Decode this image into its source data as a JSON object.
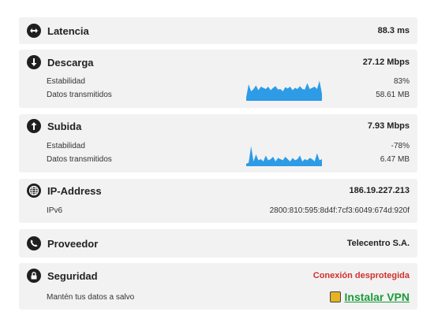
{
  "latency": {
    "title": "Latencia",
    "value": "88.3 ms",
    "icon": "arrows-horizontal-icon"
  },
  "download": {
    "title": "Descarga",
    "value": "27.12 Mbps",
    "icon": "arrow-down-icon",
    "stability_label": "Estabilidad",
    "stability_value": "83%",
    "data_label": "Datos transmitidos",
    "data_value": "58.61 MB",
    "sparkline": [
      0.15,
      0.7,
      0.4,
      0.5,
      0.65,
      0.45,
      0.6,
      0.55,
      0.5,
      0.6,
      0.45,
      0.55,
      0.62,
      0.48,
      0.5,
      0.4,
      0.58,
      0.52,
      0.6,
      0.45,
      0.55,
      0.5,
      0.62,
      0.5,
      0.48,
      0.75,
      0.5,
      0.55,
      0.6,
      0.5,
      0.85,
      0.3
    ],
    "sparkline_color": "#2e9be6"
  },
  "upload": {
    "title": "Subida",
    "value": "7.93 Mbps",
    "icon": "arrow-up-icon",
    "stability_label": "Estabilidad",
    "stability_value": "-78%",
    "data_label": "Datos transmitidos",
    "data_value": "6.47 MB",
    "sparkline": [
      0.1,
      0.15,
      0.85,
      0.2,
      0.5,
      0.25,
      0.3,
      0.2,
      0.45,
      0.25,
      0.3,
      0.4,
      0.2,
      0.35,
      0.3,
      0.25,
      0.4,
      0.3,
      0.2,
      0.35,
      0.25,
      0.3,
      0.45,
      0.2,
      0.3,
      0.25,
      0.35,
      0.3,
      0.2,
      0.55,
      0.25,
      0.3
    ],
    "sparkline_color": "#2e9be6"
  },
  "ip": {
    "title": "IP-Address",
    "value": "186.19.227.213",
    "icon": "globe-icon",
    "ipv6_label": "IPv6",
    "ipv6_value": "2800:810:595:8d4f:7cf3:6049:674d:920f"
  },
  "provider": {
    "title": "Proveedor",
    "value": "Telecentro S.A.",
    "icon": "phone-icon"
  },
  "security": {
    "title": "Seguridad",
    "status": "Conexión desprotegida",
    "status_color": "#d0312d",
    "icon": "lock-icon",
    "hint": "Mantén tus datos a salvo",
    "vpn_label": "Instalar VPN",
    "vpn_color": "#1a9b3a"
  }
}
